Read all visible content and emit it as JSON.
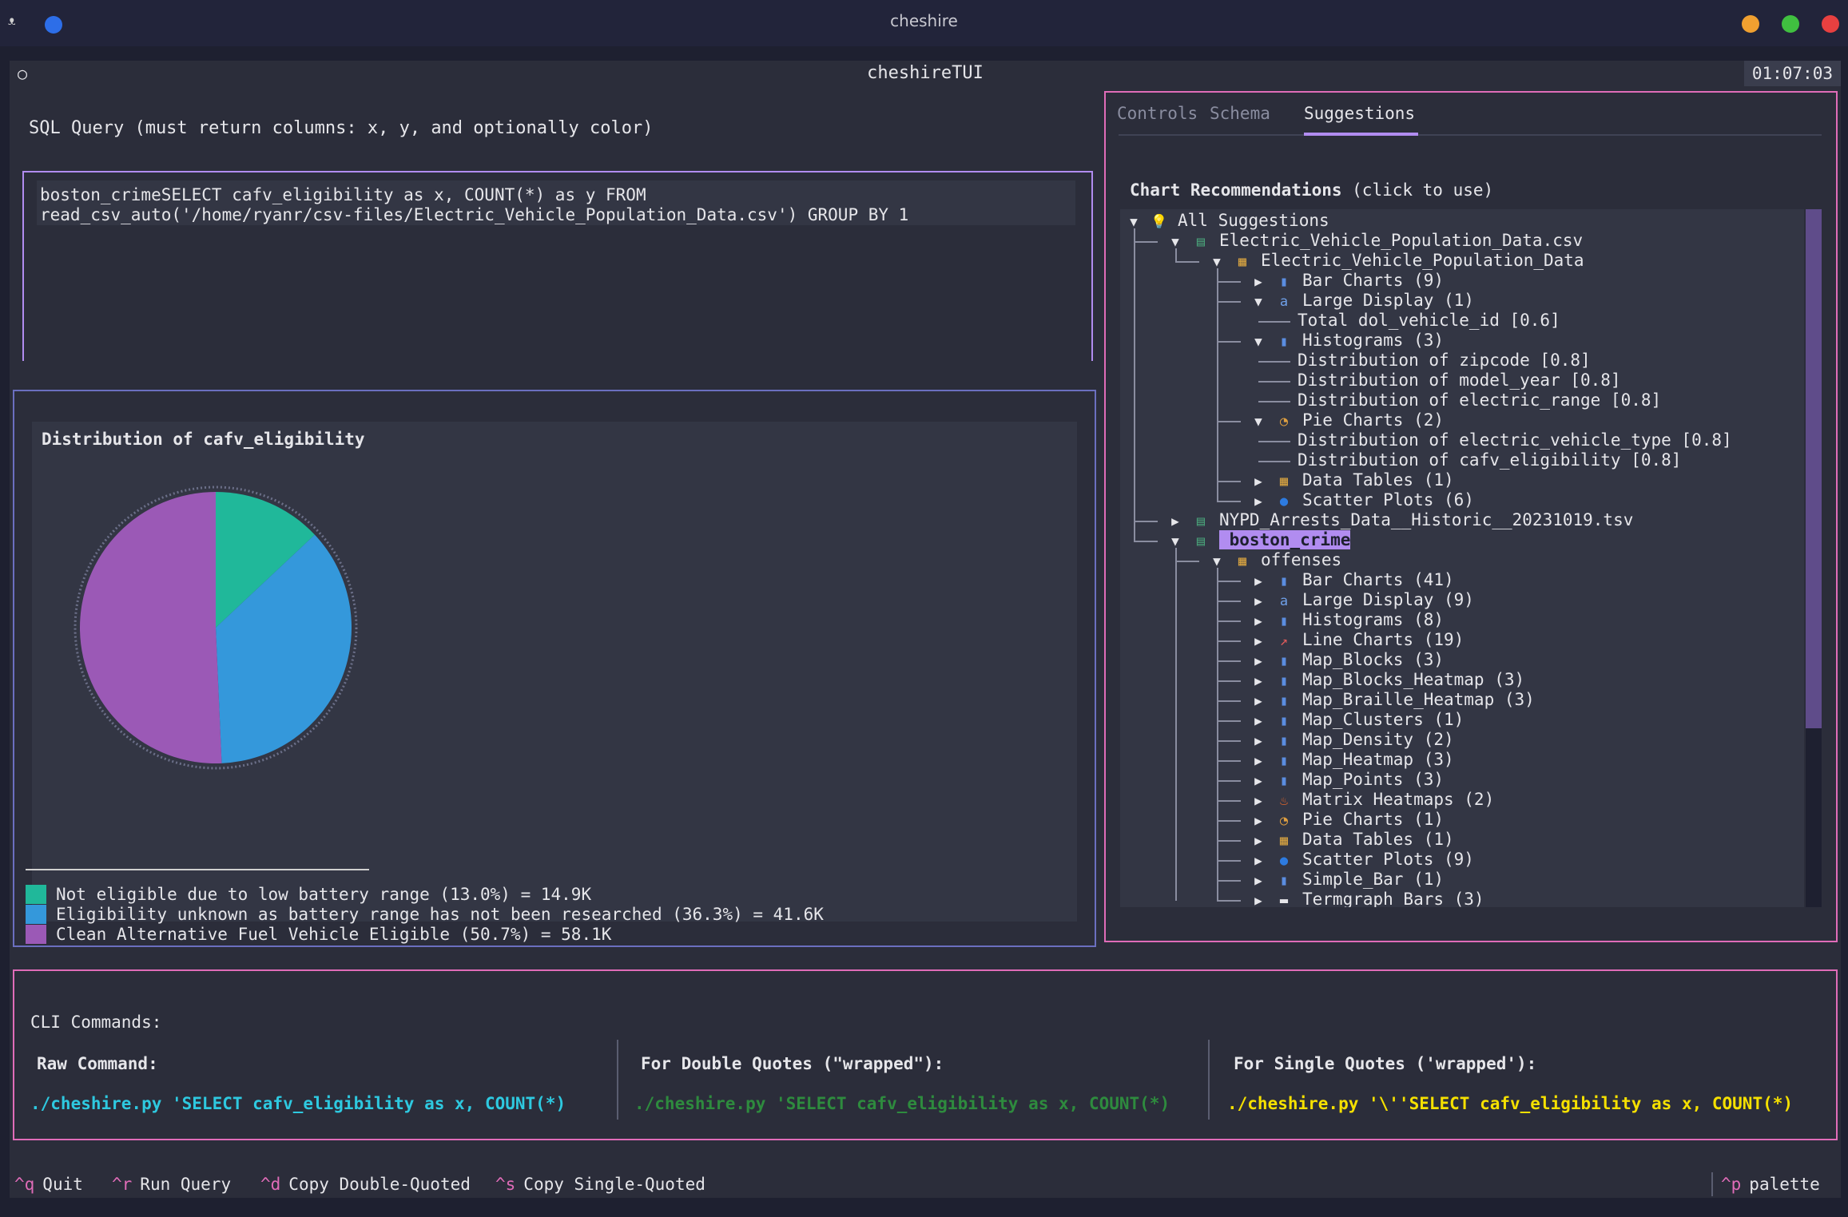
{
  "window": {
    "title": "cheshire"
  },
  "header": {
    "title": "cheshireTUI",
    "clock": "01:07:03"
  },
  "sql": {
    "label": "SQL Query (must return columns: x, y, and optionally color)",
    "line1": "boston_crimeSELECT cafv_eligibility as x, COUNT(*) as y FROM",
    "line2": "read_csv_auto('/home/ryanr/csv-files/Electric_Vehicle_Population_Data.csv') GROUP BY 1"
  },
  "chart": {
    "title": "Distribution of cafv_eligibility",
    "legend": [
      {
        "text": "Not eligible due to low battery range (13.0%) = 14.9K",
        "color": "#20b89a"
      },
      {
        "text": "Eligibility unknown as battery range has not been researched (36.3%) = 41.6K",
        "color": "#3498db"
      },
      {
        "text": "Clean Alternative Fuel Vehicle Eligible (50.7%) = 58.1K",
        "color": "#9b59b6"
      }
    ]
  },
  "chart_data": {
    "type": "pie",
    "title": "Distribution of cafv_eligibility",
    "categories": [
      "Not eligible due to low battery range",
      "Eligibility unknown as battery range has not been researched",
      "Clean Alternative Fuel Vehicle Eligible"
    ],
    "values": [
      14.9,
      41.6,
      58.1
    ],
    "percent": [
      13.0,
      36.3,
      50.7
    ],
    "colors": [
      "#20b89a",
      "#3498db",
      "#9b59b6"
    ],
    "legend_position": "bottom-left"
  },
  "tabs": [
    "Controls",
    "Schema",
    "Suggestions"
  ],
  "recommendations_title": "Chart Recommendations",
  "recommendations_hint": " (click to use)",
  "tree": [
    {
      "depth": 0,
      "arrow": "▼",
      "icon": "lightbulb-icon",
      "color": "#f5c542",
      "label": "All Suggestions"
    },
    {
      "depth": 1,
      "arrow": "▼",
      "icon": "database-icon",
      "color": "#4aa37a",
      "label": "Electric_Vehicle_Population_Data.csv"
    },
    {
      "depth": 2,
      "arrow": "▼",
      "icon": "clipboard-icon",
      "color": "#d9a441",
      "label": "Electric_Vehicle_Population_Data"
    },
    {
      "depth": 3,
      "arrow": "▶",
      "icon": "bar-chart-icon",
      "color": "#5b8de0",
      "label": "Bar Charts (9)"
    },
    {
      "depth": 3,
      "arrow": "▼",
      "icon": "abc-icon",
      "color": "#6fa0e8",
      "label": "Large Display (1)"
    },
    {
      "depth": 4,
      "arrow": "",
      "icon": "",
      "color": "",
      "label": "Total dol_vehicle_id [0.6]"
    },
    {
      "depth": 3,
      "arrow": "▼",
      "icon": "bar-chart-icon",
      "color": "#5b8de0",
      "label": "Histograms (3)"
    },
    {
      "depth": 4,
      "arrow": "",
      "icon": "",
      "color": "",
      "label": "Distribution of zipcode [0.8]"
    },
    {
      "depth": 4,
      "arrow": "",
      "icon": "",
      "color": "",
      "label": "Distribution of model_year [0.8]"
    },
    {
      "depth": 4,
      "arrow": "",
      "icon": "",
      "color": "",
      "label": "Distribution of electric_range [0.8]"
    },
    {
      "depth": 3,
      "arrow": "▼",
      "icon": "pie-icon",
      "color": "#e0a040",
      "label": "Pie Charts (2)"
    },
    {
      "depth": 4,
      "arrow": "",
      "icon": "",
      "color": "",
      "label": "Distribution of electric_vehicle_type [0.8]"
    },
    {
      "depth": 4,
      "arrow": "",
      "icon": "",
      "color": "",
      "label": "Distribution of cafv_eligibility [0.8]"
    },
    {
      "depth": 3,
      "arrow": "▶",
      "icon": "clipboard-icon",
      "color": "#d9a441",
      "label": "Data Tables (1)"
    },
    {
      "depth": 3,
      "arrow": "▶",
      "icon": "blue-circle-icon",
      "color": "#2d7be0",
      "label": "Scatter Plots (6)"
    },
    {
      "depth": 1,
      "arrow": "▶",
      "icon": "database-icon",
      "color": "#4aa37a",
      "label": "NYPD_Arrests_Data__Historic__20231019.tsv"
    },
    {
      "depth": 1,
      "arrow": "▼",
      "icon": "database-icon",
      "color": "#4aa37a",
      "label": " boston_crime",
      "highlight": true
    },
    {
      "depth": 2,
      "arrow": "▼",
      "icon": "clipboard-icon",
      "color": "#d9a441",
      "label": "offenses"
    },
    {
      "depth": 3,
      "arrow": "▶",
      "icon": "bar-chart-icon",
      "color": "#5b8de0",
      "label": "Bar Charts (41)"
    },
    {
      "depth": 3,
      "arrow": "▶",
      "icon": "abc-icon",
      "color": "#6fa0e8",
      "label": "Large Display (9)"
    },
    {
      "depth": 3,
      "arrow": "▶",
      "icon": "bar-chart-icon",
      "color": "#5b8de0",
      "label": "Histograms (8)"
    },
    {
      "depth": 3,
      "arrow": "▶",
      "icon": "line-chart-icon",
      "color": "#e05b5b",
      "label": "Line Charts (19)"
    },
    {
      "depth": 3,
      "arrow": "▶",
      "icon": "bar-chart-icon",
      "color": "#5b8de0",
      "label": "Map_Blocks (3)"
    },
    {
      "depth": 3,
      "arrow": "▶",
      "icon": "bar-chart-icon",
      "color": "#5b8de0",
      "label": "Map_Blocks_Heatmap (3)"
    },
    {
      "depth": 3,
      "arrow": "▶",
      "icon": "bar-chart-icon",
      "color": "#5b8de0",
      "label": "Map_Braille_Heatmap (3)"
    },
    {
      "depth": 3,
      "arrow": "▶",
      "icon": "bar-chart-icon",
      "color": "#5b8de0",
      "label": "Map_Clusters (1)"
    },
    {
      "depth": 3,
      "arrow": "▶",
      "icon": "bar-chart-icon",
      "color": "#5b8de0",
      "label": "Map_Density (2)"
    },
    {
      "depth": 3,
      "arrow": "▶",
      "icon": "bar-chart-icon",
      "color": "#5b8de0",
      "label": "Map_Heatmap (3)"
    },
    {
      "depth": 3,
      "arrow": "▶",
      "icon": "bar-chart-icon",
      "color": "#5b8de0",
      "label": "Map_Points (3)"
    },
    {
      "depth": 3,
      "arrow": "▶",
      "icon": "fire-icon",
      "color": "#ef6a2a",
      "label": "Matrix Heatmaps (2)"
    },
    {
      "depth": 3,
      "arrow": "▶",
      "icon": "pie-icon",
      "color": "#e0a040",
      "label": "Pie Charts (1)"
    },
    {
      "depth": 3,
      "arrow": "▶",
      "icon": "clipboard-icon",
      "color": "#d9a441",
      "label": "Data Tables (1)"
    },
    {
      "depth": 3,
      "arrow": "▶",
      "icon": "blue-circle-icon",
      "color": "#2d7be0",
      "label": "Scatter Plots (9)"
    },
    {
      "depth": 3,
      "arrow": "▶",
      "icon": "bar-chart-icon",
      "color": "#5b8de0",
      "label": "Simple_Bar (1)"
    },
    {
      "depth": 3,
      "arrow": "▶",
      "icon": "dash-icon",
      "color": "#e6e6ea",
      "label": "Termgraph Bars (3)"
    }
  ],
  "cli": {
    "title": "CLI Commands:",
    "raw_title": "Raw Command:",
    "raw_cmd": "./cheshire.py 'SELECT cafv_eligibility as x, COUNT(*)",
    "double_title": "For Double Quotes (\"wrapped\"):",
    "double_cmd": "./cheshire.py 'SELECT cafv_eligibility as x, COUNT(*)",
    "single_title": "For Single Quotes ('wrapped'):",
    "single_cmd": "./cheshire.py '\\''SELECT cafv_eligibility as x, COUNT(*)",
    "colors": {
      "raw": "#2ec9e0",
      "double": "#2e8b3e",
      "single": "#f5e000"
    }
  },
  "footer": {
    "items": [
      {
        "key": "^q",
        "label": "Quit"
      },
      {
        "key": "^r",
        "label": "Run Query"
      },
      {
        "key": "^d",
        "label": "Copy Double-Quoted"
      },
      {
        "key": "^s",
        "label": "Copy Single-Quoted"
      }
    ],
    "palette_key": "^p",
    "palette_label": "palette"
  }
}
